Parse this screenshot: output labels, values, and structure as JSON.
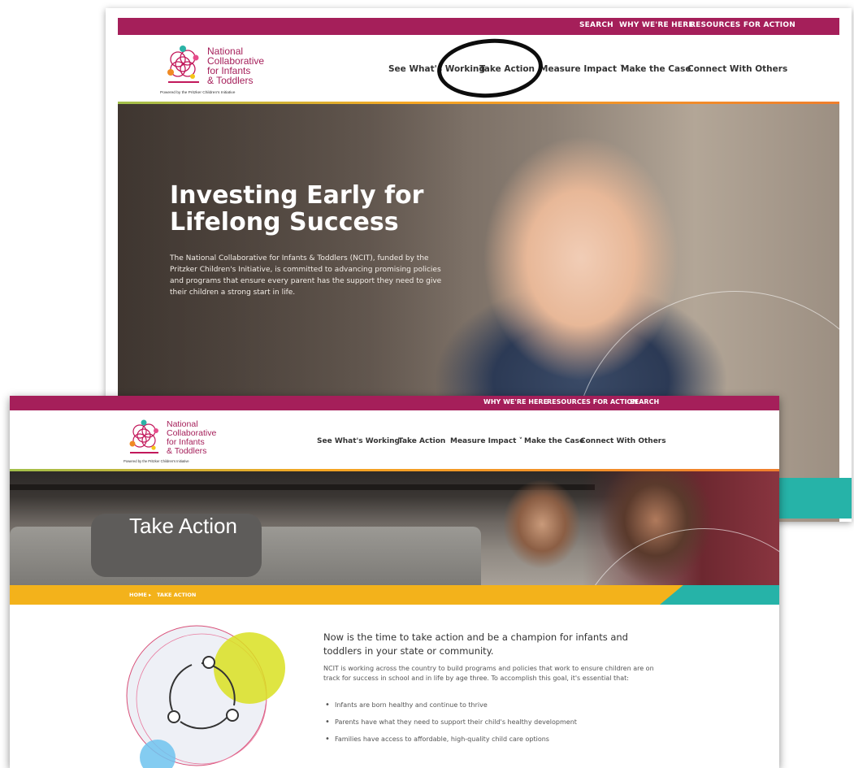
{
  "back_window": {
    "utility_links": [
      "SEARCH",
      "WHY WE'RE HERE",
      "RESOURCES FOR ACTION"
    ],
    "logo": {
      "lines": [
        "National",
        "Collaborative",
        "for Infants",
        "& Toddlers"
      ],
      "tagline": "Powered by the Pritzker Children's Initiative"
    },
    "nav": [
      "See What's Working",
      "Take Action",
      "Measure Impact ˅",
      "Make the Case",
      "Connect With Others"
    ],
    "hero": {
      "title": "Investing Early for Lifelong Success",
      "text": "The National Collaborative for Infants & Toddlers (NCIT), funded by the Pritzker Children's Initiative, is committed to advancing promising policies and programs that ensure every parent has the support they need to give their children a strong start in life."
    }
  },
  "front_window": {
    "utility_links": [
      "WHY WE'RE HERE",
      "RESOURCES FOR ACTION",
      "SEARCH"
    ],
    "logo": {
      "lines": [
        "National",
        "Collaborative",
        "for Infants",
        "& Toddlers"
      ],
      "tagline": "Powered by the Pritzker Children's Initiative"
    },
    "nav": [
      "See What's Working",
      "Take Action",
      "Measure Impact ˅",
      "Make the Case",
      "Connect With Others"
    ],
    "page_title": "Take Action",
    "breadcrumb": {
      "home": "HOME",
      "separator": "▸",
      "current": "TAKE ACTION"
    },
    "lead": "Now is the time to take action and be a champion for infants and toddlers in your state or community.",
    "body": "NCIT is working across the country to build programs and policies that work to ensure children are on track for success in school and in life by age three. To accomplish this goal, it's essential that:",
    "bullets": [
      "Infants are born healthy and continue to thrive",
      "Parents have what they need to support their child's healthy development",
      "Families have access to affordable, high-quality child care options"
    ]
  },
  "colors": {
    "brand_magenta": "#a51f5a",
    "accent_orange": "#f07f2d",
    "breadcrumb_yellow": "#f3b21b",
    "teal": "#26b3a8",
    "illustration_lime": "#d9e021",
    "illustration_blue": "#6fc3ee"
  },
  "icons": [
    "ncit-logo-icon",
    "cycle-arrows-icon",
    "annotation-circle"
  ]
}
